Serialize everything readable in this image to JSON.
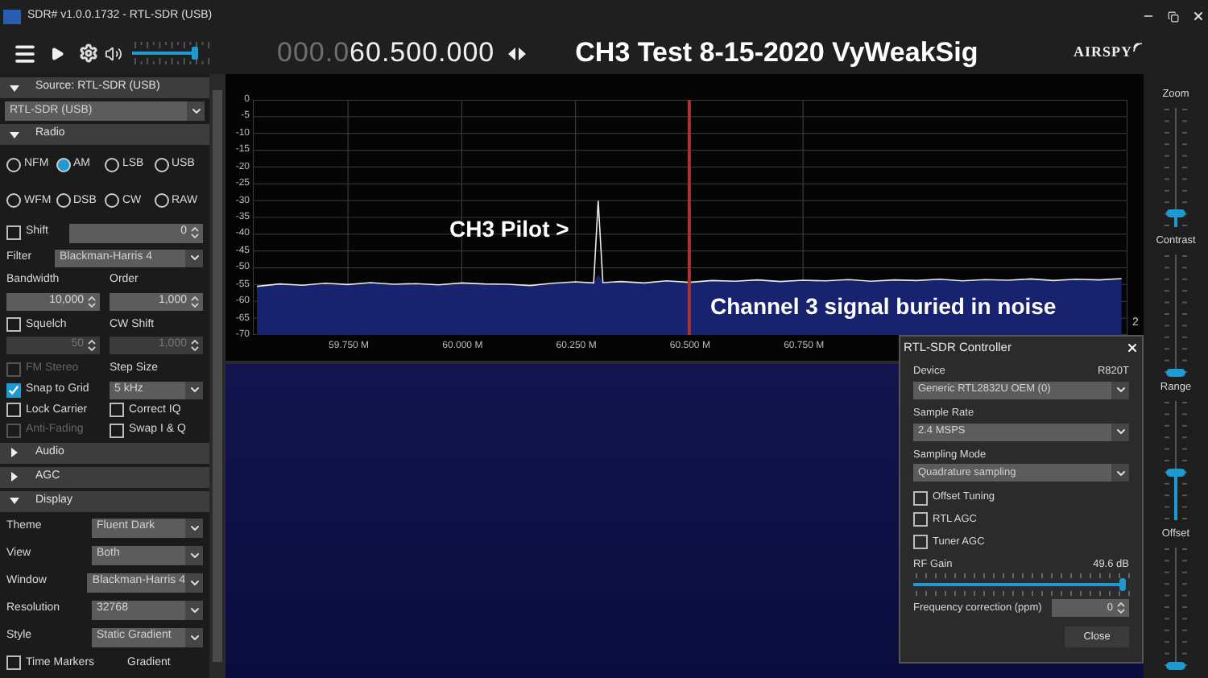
{
  "window": {
    "title": "SDR# v1.0.0.1732 - RTL-SDR (USB)"
  },
  "toolbar": {
    "frequency_prefix": "000.0",
    "frequency": "60.500.000",
    "volume": {
      "level": 0.78
    },
    "caption": "CH3 Test 8-15-2020  VyWeakSig",
    "logo": "AIRSPY"
  },
  "sidebar": {
    "source": {
      "header": "Source: RTL-SDR (USB)",
      "expanded": true,
      "device": "RTL-SDR (USB)"
    },
    "radio": {
      "header": "Radio",
      "expanded": true,
      "modes": [
        {
          "label": "NFM",
          "selected": false
        },
        {
          "label": "AM",
          "selected": true
        },
        {
          "label": "LSB",
          "selected": false
        },
        {
          "label": "USB",
          "selected": false
        },
        {
          "label": "WFM",
          "selected": false
        },
        {
          "label": "DSB",
          "selected": false
        },
        {
          "label": "CW",
          "selected": false
        },
        {
          "label": "RAW",
          "selected": false
        }
      ],
      "shift": {
        "label": "Shift",
        "checked": false,
        "value": "0"
      },
      "filter": {
        "label": "Filter",
        "value": "Blackman-Harris 4"
      },
      "bandwidth": {
        "label": "Bandwidth",
        "value": "10,000"
      },
      "order": {
        "label": "Order",
        "value": "1,000"
      },
      "squelch": {
        "label": "Squelch",
        "checked": false
      },
      "squelch_level": {
        "value": "50",
        "disabled": true
      },
      "cw_shift": {
        "label": "CW Shift",
        "value": "1,000",
        "disabled": true
      },
      "step_size": {
        "label": "Step Size",
        "value": "5 kHz"
      },
      "options": [
        {
          "label": "FM Stereo",
          "checked": false,
          "disabled": true
        },
        {
          "label": "Snap to Grid",
          "checked": true,
          "disabled": false
        },
        {
          "label": "Lock Carrier",
          "checked": false,
          "disabled": false
        },
        {
          "label": "Correct IQ",
          "checked": false,
          "disabled": false
        },
        {
          "label": "Anti-Fading",
          "checked": false,
          "disabled": true
        },
        {
          "label": "Swap I & Q",
          "checked": false,
          "disabled": false
        }
      ]
    },
    "sections": [
      {
        "header": "Audio",
        "expanded": false
      },
      {
        "header": "AGC",
        "expanded": false
      },
      {
        "header": "Display",
        "expanded": true
      }
    ],
    "display": {
      "settings": [
        {
          "label": "Theme",
          "value": "Fluent Dark"
        },
        {
          "label": "View",
          "value": "Both"
        },
        {
          "label": "Window",
          "value": "Blackman-Harris 4"
        },
        {
          "label": "Resolution",
          "value": "32768"
        },
        {
          "label": "Style",
          "value": "Static Gradient"
        }
      ],
      "time_markers": {
        "label": "Time Markers",
        "checked": false
      },
      "gradient_label": "Gradient"
    }
  },
  "spectrum": {
    "chart_data": {
      "type": "line",
      "grid": true,
      "xlim": [
        59.541,
        61.463
      ],
      "ylim": [
        -70,
        0
      ],
      "ref_lines": [
        {
          "axis": "x",
          "value": 60.5,
          "color": "#aa3333"
        }
      ],
      "yticks": [
        0,
        -5,
        -10,
        -15,
        -20,
        -25,
        -30,
        -35,
        -40,
        -45,
        -50,
        -55,
        -60,
        -65,
        -70
      ],
      "xticks": [
        {
          "value": 59.75,
          "label": "59.750 M"
        },
        {
          "value": 60.0,
          "label": "60.000 M"
        },
        {
          "value": 60.25,
          "label": "60.250 M"
        },
        {
          "value": 60.5,
          "label": "60.500 M"
        },
        {
          "value": 60.75,
          "label": "60.750 M"
        }
      ],
      "x": [
        59.55,
        59.6,
        59.65,
        59.7,
        59.75,
        59.8,
        59.85,
        59.9,
        59.95,
        60.0,
        60.05,
        60.1,
        60.15,
        60.2,
        60.25,
        60.29,
        60.3,
        60.31,
        60.35,
        60.4,
        60.45,
        60.5,
        60.55,
        60.6,
        60.65,
        60.7,
        60.75,
        60.8,
        60.85,
        60.9,
        60.95,
        61.0,
        61.05,
        61.1,
        61.15,
        61.2,
        61.25,
        61.3,
        61.35,
        61.4,
        61.45
      ],
      "series": [
        {
          "color": "#e8e8f0",
          "values": [
            -55.5,
            -54.8,
            -55.2,
            -54.6,
            -55.0,
            -54.4,
            -54.9,
            -54.7,
            -55.1,
            -54.5,
            -54.8,
            -54.9,
            -55.3,
            -54.6,
            -54.2,
            -54.5,
            -30,
            -54.4,
            -54.1,
            -54.5,
            -53.9,
            -54.3,
            -53.8,
            -54.0,
            -53.6,
            -54.1,
            -53.7,
            -53.9,
            -53.5,
            -54.0,
            -53.6,
            -53.8,
            -53.4,
            -53.9,
            -53.5,
            -53.7,
            -53.3,
            -53.8,
            -53.4,
            -53.6,
            -53.2
          ]
        }
      ]
    },
    "pilot_note": "CH3 Pilot >",
    "noise_note": "Channel 3 signal buried in noise",
    "corner_label": "2"
  },
  "sliders": [
    {
      "label": "Zoom",
      "level": 0.12
    },
    {
      "label": "Contrast",
      "level": 0.0
    },
    {
      "label": "Range",
      "level": 0.42
    },
    {
      "label": "Offset",
      "level": 0.0
    }
  ],
  "dialog": {
    "title": "RTL-SDR Controller",
    "device_label": "Device",
    "tuner": "R820T",
    "device": "Generic RTL2832U OEM (0)",
    "sample_rate_label": "Sample Rate",
    "sample_rate": "2.4 MSPS",
    "sampling_mode_label": "Sampling Mode",
    "sampling_mode": "Quadrature sampling",
    "options": [
      {
        "label": "Offset Tuning",
        "checked": false
      },
      {
        "label": "RTL AGC",
        "checked": false
      },
      {
        "label": "Tuner AGC",
        "checked": false
      }
    ],
    "rf_gain_label": "RF Gain",
    "rf_gain_reading": "49.6 dB",
    "rf_gain": {
      "level": 0.98
    },
    "ppm_label": "Frequency correction (ppm)",
    "ppm": "0",
    "close_button": "Close"
  }
}
